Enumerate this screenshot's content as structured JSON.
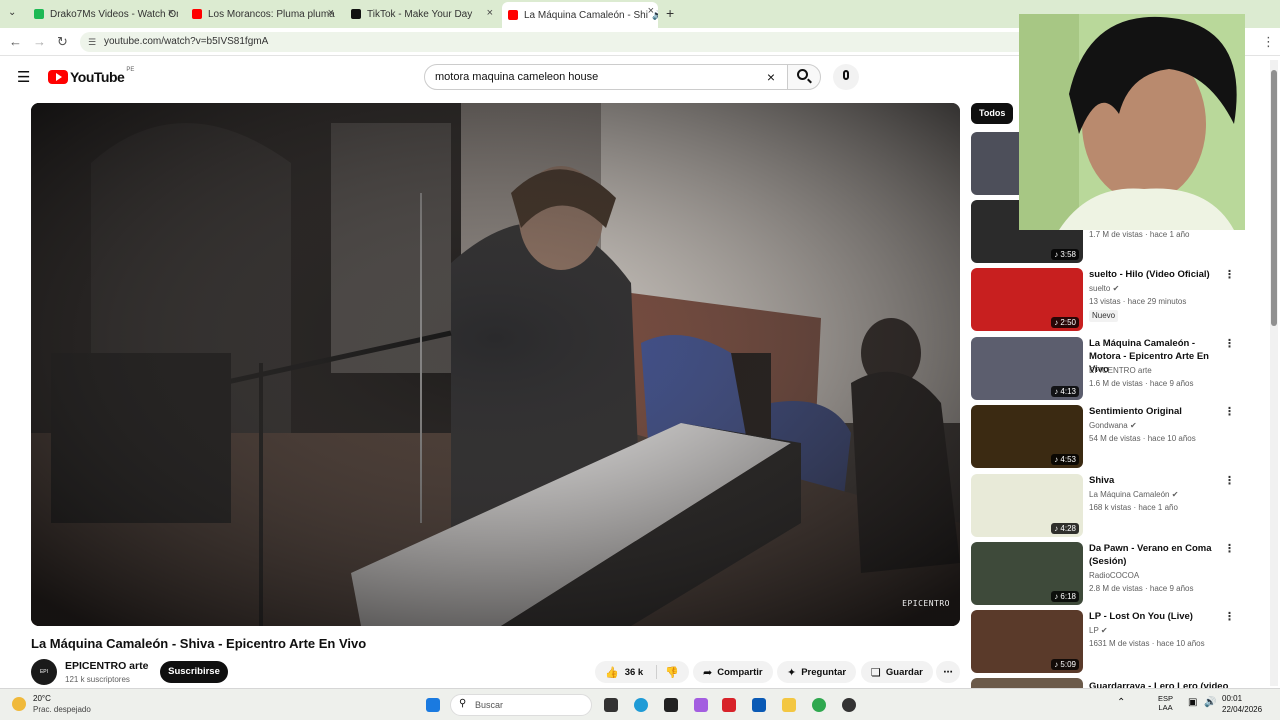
{
  "browser": {
    "tabs": [
      {
        "label": "Drako7Ms Videos - Watch On-D",
        "color": "#1db954"
      },
      {
        "label": "Los Morancos: Pluma pluma Ge",
        "color": "#ff0000"
      },
      {
        "label": "TikTok - Make Your Day",
        "color": "#111111"
      },
      {
        "label": "La Máquina Camaleón - Shi",
        "color": "#ff0000"
      }
    ],
    "new_tab": "+",
    "url": "youtube.com/watch?v=b5IVS81fgmA"
  },
  "youtube": {
    "logo_text": "YouTube",
    "region": "PE",
    "search_value": "motora maquina cameleon house"
  },
  "video": {
    "watermark": "EPICENTRO",
    "title": "La Máquina Camaleón - Shiva - Epicentro Arte En Vivo",
    "channel_name": "EPICENTRO arte",
    "subscribers": "121 k suscriptores",
    "subscribe_label": "Suscribirse",
    "likes": "36 k",
    "share_label": "Compartir",
    "ask_label": "Preguntar",
    "save_label": "Guardar"
  },
  "sidebar": {
    "chip_all": "Todos",
    "items": [
      {
        "title": "",
        "channel": "",
        "views": "",
        "duration": "",
        "thumb": "#4d4f5a"
      },
      {
        "title": "",
        "channel": "",
        "views": "1.7 M de vistas · hace 1 año",
        "duration": "3:58",
        "thumb": "#2b2b2b"
      },
      {
        "title": "suelto - Hilo (Video Oficial)",
        "channel": "suelto",
        "views": "13 vistas · hace 29 minutos",
        "badge": "Nuevo",
        "duration": "2:50",
        "thumb": "#c81f1f"
      },
      {
        "title": "La Máquina Camaleón - Motora - Epicentro Arte En Vivo",
        "channel": "EPICENTRO arte",
        "views": "1.6 M de vistas · hace 9 años",
        "duration": "4:13",
        "thumb": "#5c5e6e"
      },
      {
        "title": "Sentimiento Original",
        "channel": "Gondwana",
        "views": "54 M de vistas · hace 10 años",
        "duration": "4:53",
        "thumb": "#3b2a12"
      },
      {
        "title": "Shiva",
        "channel": "La Máquina Camaleón",
        "views": "168 k vistas · hace 1 año",
        "duration": "4:28",
        "thumb": "#e8ead8"
      },
      {
        "title": "Da Pawn - Verano en Coma (Sesión)",
        "channel": "RadioCOCOA",
        "views": "2.8 M de vistas · hace 9 años",
        "duration": "6:18",
        "thumb": "#3e4a3a"
      },
      {
        "title": "LP - Lost On You (Live)",
        "channel": "LP",
        "views": "1631 M de vistas · hace 10 años",
        "duration": "5:09",
        "thumb": "#5a3a2a"
      },
      {
        "title": "Guardarraya - Lero Lero (video",
        "channel": "",
        "views": "",
        "duration": "",
        "thumb": "#6b5a4a"
      }
    ]
  },
  "taskbar": {
    "weather_temp": "20°C",
    "weather_desc": "Prac. despejado",
    "search_placeholder": "Buscar",
    "lang": "ESP",
    "layout": "LAA",
    "time": "00:01",
    "date": "22/04/2026"
  }
}
